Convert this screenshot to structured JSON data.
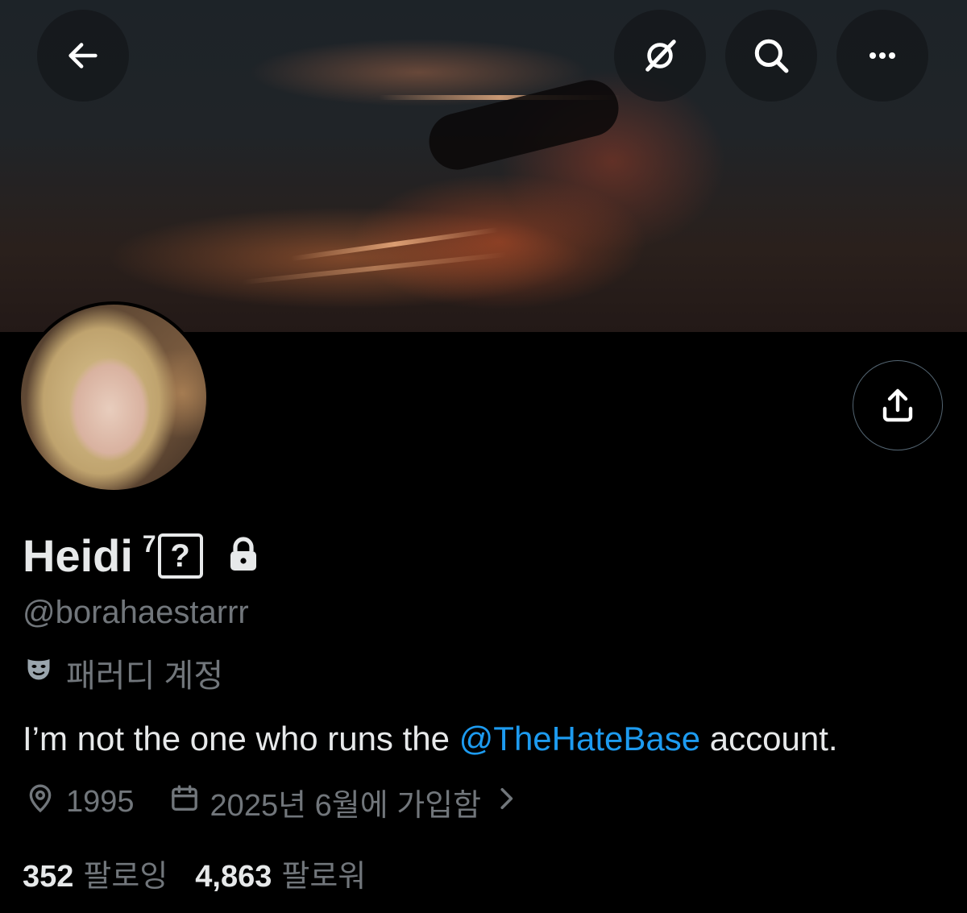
{
  "header": {
    "back_icon": "arrow-left-icon",
    "grok_icon": "grok-icon",
    "search_icon": "search-icon",
    "more_icon": "more-horizontal-icon"
  },
  "profile": {
    "name": "Heidi",
    "name_suffix": "7",
    "name_badge": "?",
    "protected_icon": "lock-icon",
    "handle": "@borahaestarrr",
    "parody_label": "패러디 계정",
    "bio_prefix": "I’m not the one who runs the ",
    "bio_mention": "@TheHateBase",
    "bio_suffix": " account.",
    "location": "1995",
    "joined": "2025년 6월에 가입함",
    "following_count": "352",
    "following_label": "팔로잉",
    "followers_count": "4,863",
    "followers_label": "팔로워"
  },
  "colors": {
    "background": "#000000",
    "text_primary": "#e7e9ea",
    "text_secondary": "#71767b",
    "accent": "#1d9bf0"
  }
}
